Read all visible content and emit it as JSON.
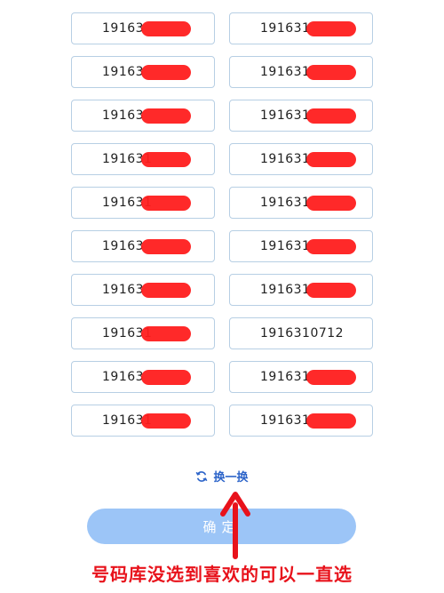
{
  "numbers": [
    {
      "visible": "19163",
      "redacted": true
    },
    {
      "visible": "191631",
      "redacted": true
    },
    {
      "visible": "19163",
      "redacted": true
    },
    {
      "visible": "191631",
      "redacted": true
    },
    {
      "visible": "19163",
      "redacted": true
    },
    {
      "visible": "191631",
      "redacted": true
    },
    {
      "visible": "191631",
      "redacted": true
    },
    {
      "visible": "191631",
      "redacted": true
    },
    {
      "visible": "191631",
      "redacted": true
    },
    {
      "visible": "191631",
      "redacted": true
    },
    {
      "visible": "19163",
      "redacted": true
    },
    {
      "visible": "191631",
      "redacted": true
    },
    {
      "visible": "19163",
      "redacted": true
    },
    {
      "visible": "191631",
      "redacted": true
    },
    {
      "visible": "191631",
      "redacted": true
    },
    {
      "visible": "1916310712",
      "redacted": false
    },
    {
      "visible": "19163",
      "redacted": true
    },
    {
      "visible": "191631",
      "redacted": true
    },
    {
      "visible": "191631",
      "redacted": true
    },
    {
      "visible": "191631",
      "redacted": true
    }
  ],
  "swap_label": "换一换",
  "swap_icon": "refresh-icon",
  "confirm_label": "确定",
  "caption": "号码库没选到喜欢的可以一直选",
  "colors": {
    "accent": "#2c64c9",
    "button": "#9cc5f7",
    "redact": "#ff1e1e",
    "annotation": "#e8121b"
  }
}
